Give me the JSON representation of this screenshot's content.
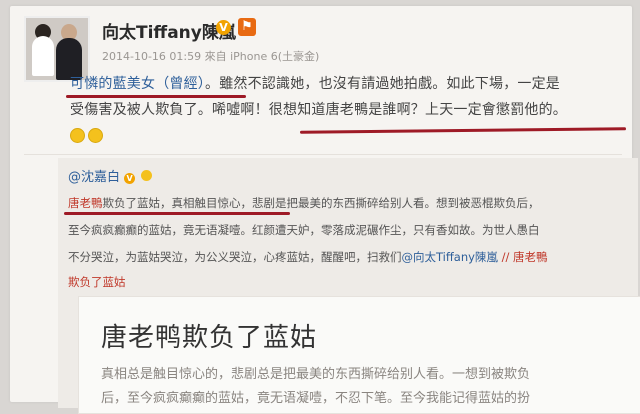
{
  "post": {
    "username": "向太Tiffany陳嵐",
    "verified_badge": "V",
    "timestamp": "2014-10-16 01:59 來自 iPhone 6(土豪金)",
    "lines": [
      {
        "parts": [
          {
            "text": "可憐的藍美女（曾經）",
            "hl": true
          },
          {
            "text": "。雖然不認識她，也沒有請過她拍戲。如此下場，一定是",
            "hl": false
          }
        ]
      },
      {
        "parts": [
          {
            "text": "受傷害及被人欺負了。唏噓啊！很想知道唐老鴨是誰啊？上天一定會懲罰他的。",
            "hl": false
          }
        ]
      }
    ],
    "emoji_count": 2
  },
  "repost": {
    "author": "@沈嘉白",
    "author_badge": "V",
    "lines": [
      {
        "parts": [
          {
            "text": "唐老鴨",
            "cls": "red"
          },
          {
            "text": "欺负了蓝姑，真相触目惊心，悲剧是把最美的东西撕碎给别人看。想到被恶棍欺负后，",
            "cls": ""
          }
        ]
      },
      {
        "parts": [
          {
            "text": "至今疯疯癫癫的蓝姑，竟无语凝噎。红颜遭天妒，零落成泥碾作尘，只有香如故。为世人愚白",
            "cls": ""
          }
        ]
      },
      {
        "parts": [
          {
            "text": "不分哭泣，为蓝姑哭泣，为公义哭泣，心疼蓝姑，醒醒吧，扫救们",
            "cls": ""
          },
          {
            "text": "@向太Tiffany陳嵐 ",
            "cls": "link"
          },
          {
            "text": "// 唐老鴨",
            "cls": "red"
          }
        ]
      },
      {
        "parts": [
          {
            "text": "欺负了蓝姑",
            "cls": "red"
          }
        ]
      }
    ]
  },
  "article": {
    "title": "唐老鸭欺负了蓝姑",
    "body_lines": [
      "真相总是触目惊心的，悲剧总是把最美的东西撕碎给别人看。一想到被欺负",
      "后，至今疯疯癫癫的蓝姑，竟无语凝噎，不忍下笔。至今我能记得蓝姑的扮"
    ]
  },
  "colors": {
    "underline": "#9e1a26",
    "link": "#2e5f9a",
    "badge": "#f2a300"
  }
}
